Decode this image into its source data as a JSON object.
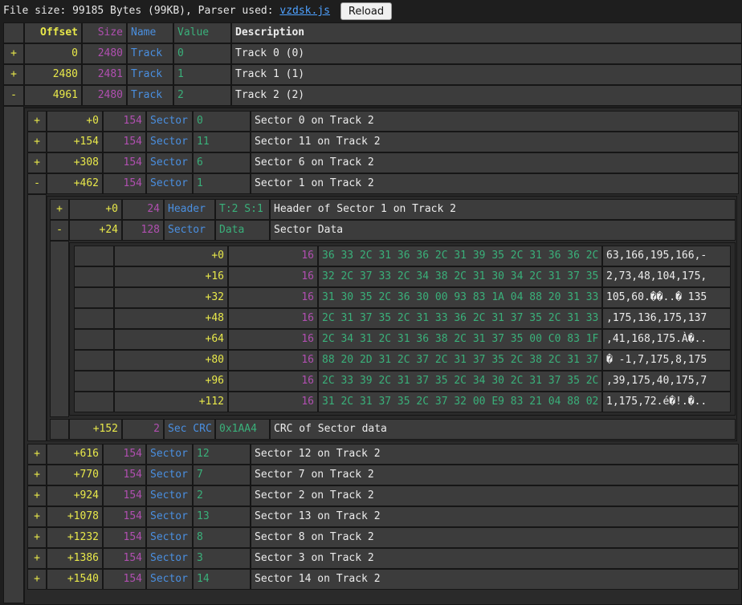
{
  "topbar": {
    "prefix": "File size: 99185 Bytes (99KB), Parser used: ",
    "parser_link": "vzdsk.js",
    "reload_label": "Reload"
  },
  "headers": {
    "offset": "Offset",
    "size": "Size",
    "name": "Name",
    "value": "Value",
    "description": "Description"
  },
  "tracks": [
    {
      "toggle": "+",
      "offset": "0",
      "size": "2480",
      "name": "Track",
      "value": "0",
      "desc": "Track 0 (0)"
    },
    {
      "toggle": "+",
      "offset": "2480",
      "size": "2481",
      "name": "Track",
      "value": "1",
      "desc": "Track 1 (1)"
    },
    {
      "toggle": "-",
      "offset": "4961",
      "size": "2480",
      "name": "Track",
      "value": "2",
      "desc": "Track 2 (2)"
    }
  ],
  "sectors_before": [
    {
      "toggle": "+",
      "offset": "+0",
      "size": "154",
      "name": "Sector",
      "value": "0",
      "desc": "Sector 0 on Track 2"
    },
    {
      "toggle": "+",
      "offset": "+154",
      "size": "154",
      "name": "Sector",
      "value": "11",
      "desc": "Sector 11 on Track 2"
    },
    {
      "toggle": "+",
      "offset": "+308",
      "size": "154",
      "name": "Sector",
      "value": "6",
      "desc": "Sector 6 on Track 2"
    },
    {
      "toggle": "-",
      "offset": "+462",
      "size": "154",
      "name": "Sector",
      "value": "1",
      "desc": "Sector 1 on Track 2"
    }
  ],
  "sector_parts": [
    {
      "toggle": "+",
      "offset": "+0",
      "size": "24",
      "name": "Header",
      "value": "T:2 S:1",
      "desc": "Header of Sector 1 on Track 2"
    },
    {
      "toggle": "-",
      "offset": "+24",
      "size": "128",
      "name": "Sector",
      "value": "Data",
      "desc": "Sector Data"
    }
  ],
  "hex_rows": [
    {
      "offset": "+0",
      "size": "16",
      "hex": "36 33 2C 31 36 36 2C 31 39 35 2C 31 36 36 2C 2D",
      "ascii": "63,166,195,166,-"
    },
    {
      "offset": "+16",
      "size": "16",
      "hex": "32 2C 37 33 2C 34 38 2C 31 30 34 2C 31 37 35 2C",
      "ascii": "2,73,48,104,175,"
    },
    {
      "offset": "+32",
      "size": "16",
      "hex": "31 30 35 2C 36 30 00 93 83 1A 04 88 20 31 33 35",
      "ascii": "105,60.��..� 135"
    },
    {
      "offset": "+48",
      "size": "16",
      "hex": "2C 31 37 35 2C 31 33 36 2C 31 37 35 2C 31 33 37",
      "ascii": ",175,136,175,137"
    },
    {
      "offset": "+64",
      "size": "16",
      "hex": "2C 34 31 2C 31 36 38 2C 31 37 35 00 C0 83 1F 04",
      "ascii": ",41,168,175.À�.."
    },
    {
      "offset": "+80",
      "size": "16",
      "hex": "88 20 2D 31 2C 37 2C 31 37 35 2C 38 2C 31 37 35",
      "ascii": "� -1,7,175,8,175"
    },
    {
      "offset": "+96",
      "size": "16",
      "hex": "2C 33 39 2C 31 37 35 2C 34 30 2C 31 37 35 2C 37",
      "ascii": ",39,175,40,175,7"
    },
    {
      "offset": "+112",
      "size": "16",
      "hex": "31 2C 31 37 35 2C 37 32 00 E9 83 21 04 88 02 02",
      "ascii": "1,175,72.é�!.�.."
    }
  ],
  "crc": {
    "offset": "+152",
    "size": "2",
    "name": "Sec CRC",
    "value": "0x1AA4",
    "desc": "CRC of Sector data"
  },
  "sectors_after": [
    {
      "toggle": "+",
      "offset": "+616",
      "size": "154",
      "name": "Sector",
      "value": "12",
      "desc": "Sector 12 on Track 2"
    },
    {
      "toggle": "+",
      "offset": "+770",
      "size": "154",
      "name": "Sector",
      "value": "7",
      "desc": "Sector 7 on Track 2"
    },
    {
      "toggle": "+",
      "offset": "+924",
      "size": "154",
      "name": "Sector",
      "value": "2",
      "desc": "Sector 2 on Track 2"
    },
    {
      "toggle": "+",
      "offset": "+1078",
      "size": "154",
      "name": "Sector",
      "value": "13",
      "desc": "Sector 13 on Track 2"
    },
    {
      "toggle": "+",
      "offset": "+1232",
      "size": "154",
      "name": "Sector",
      "value": "8",
      "desc": "Sector 8 on Track 2"
    },
    {
      "toggle": "+",
      "offset": "+1386",
      "size": "154",
      "name": "Sector",
      "value": "3",
      "desc": "Sector 3 on Track 2"
    },
    {
      "toggle": "+",
      "offset": "+1540",
      "size": "154",
      "name": "Sector",
      "value": "14",
      "desc": "Sector 14 on Track 2"
    }
  ],
  "colors": {
    "offset": "#e8e84a",
    "size": "#b04fb0",
    "name": "#4a8fe0",
    "value": "#3ab07a",
    "background": "#1e1e1e",
    "cell": "#3c3c3c"
  }
}
